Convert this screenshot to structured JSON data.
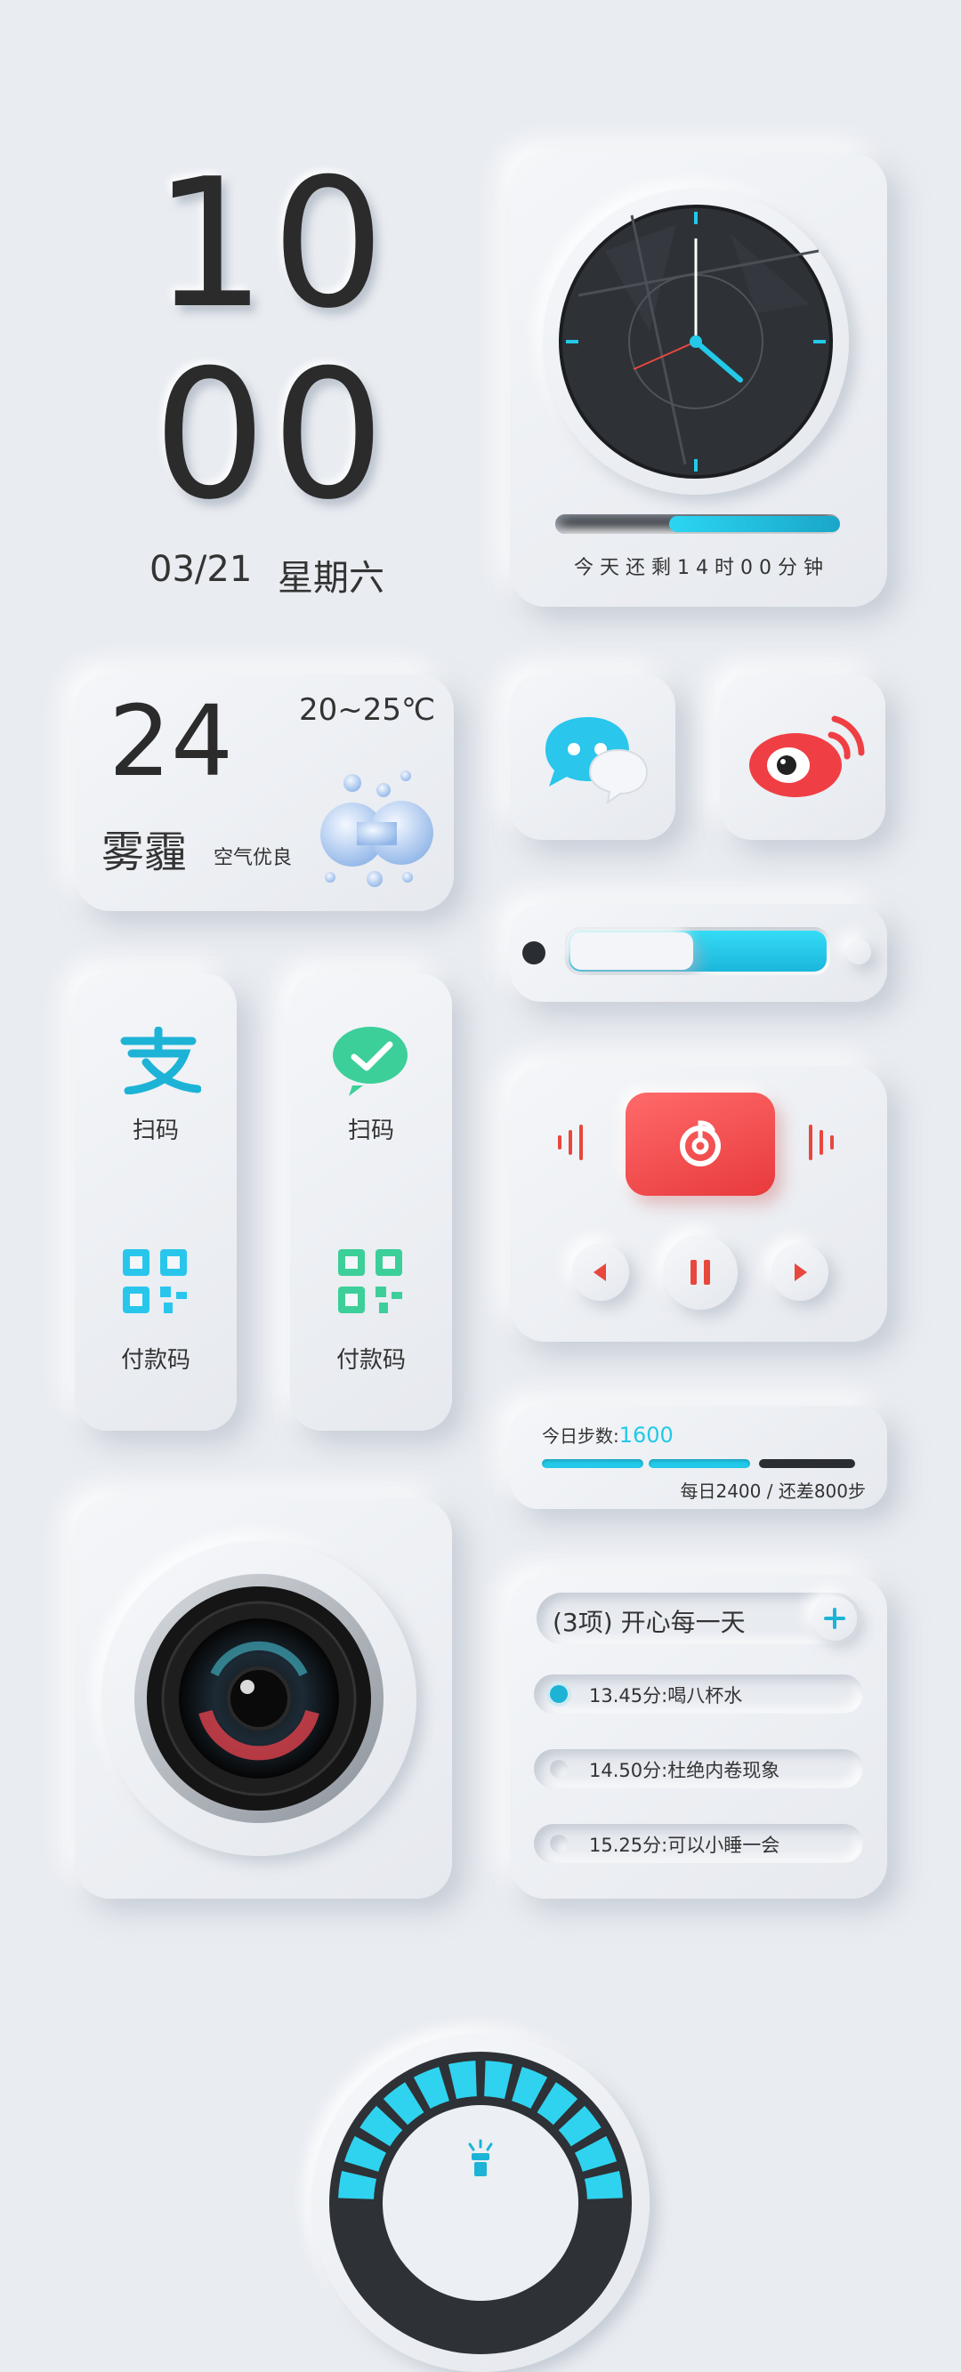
{
  "clock": {
    "hours": "10",
    "minutes": "00",
    "date": "03/21",
    "weekday": "星期六"
  },
  "timer": {
    "caption": "今 天 还 剩 1 4 时 0 0 分 钟",
    "progress": 0.35
  },
  "weather": {
    "temp": "24",
    "range": "20~25℃",
    "condition": "雾霾",
    "air": "空气优良"
  },
  "apps": {
    "chat_icon": "chat-bubbles-icon",
    "weibo_icon": "weibo-icon"
  },
  "brightness": {
    "level": 0.45
  },
  "payments": {
    "alipay": {
      "scan_label": "扫码",
      "pay_label": "付款码",
      "icon": "alipay-icon"
    },
    "wechat": {
      "scan_label": "扫码",
      "pay_label": "付款码",
      "icon": "wechat-pay-icon"
    }
  },
  "music": {
    "app_icon": "netease-music-icon",
    "accent": "#f2474a"
  },
  "steps": {
    "label": "今日步数:",
    "count": "1600",
    "goal_text": "每日2400 / 还差800步"
  },
  "todo": {
    "title": "(3项) 开心每一天",
    "items": [
      {
        "text": "13.45分:喝八杯水",
        "done": true
      },
      {
        "text": "14.50分:杜绝内卷现象",
        "done": false
      },
      {
        "text": "15.25分:可以小睡一会",
        "done": false
      }
    ]
  },
  "colors": {
    "accent": "#22c9e8",
    "background": "#e9ecf1",
    "red": "#f2474a"
  }
}
